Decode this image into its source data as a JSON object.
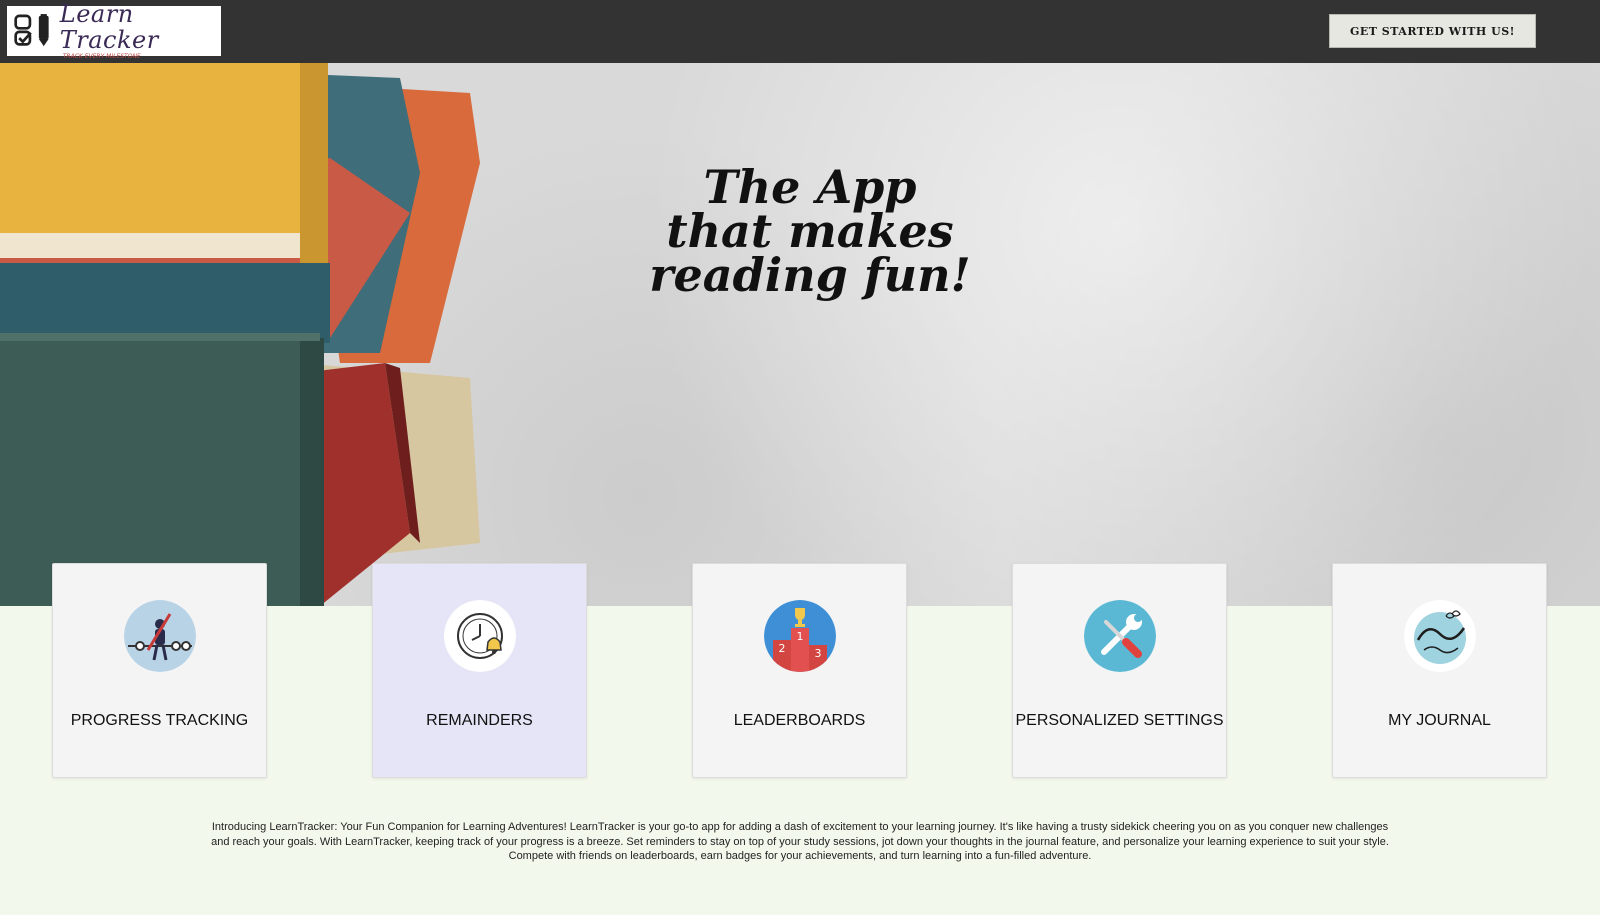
{
  "header": {
    "logo_name": "Learn Tracker",
    "logo_tagline": "TRACK EVERY MILESTONE",
    "cta_label": "GET STARTED WITH US!"
  },
  "hero": {
    "line1": "The App",
    "line2": "that makes",
    "line3": "reading fun!"
  },
  "features": [
    {
      "label": "PROGRESS TRACKING",
      "icon": "progress-tracking-icon"
    },
    {
      "label": "REMAINDERS",
      "icon": "alarm-clock-icon"
    },
    {
      "label": "LEADERBOARDS",
      "icon": "podium-trophy-icon"
    },
    {
      "label": "PERSONALIZED SETTINGS",
      "icon": "wrench-screwdriver-icon"
    },
    {
      "label": "MY JOURNAL",
      "icon": "journal-icon"
    }
  ],
  "intro_text": "Introducing LearnTracker: Your Fun Companion for Learning Adventures! LearnTracker is your go-to app for adding a dash of excitement to your learning journey. It's like having a trusty sidekick cheering you on as you conquer new challenges and reach your goals. With LearnTracker, keeping track of your progress is a breeze. Set reminders to stay on top of your study sessions, jot down your thoughts in the journal feature, and personalize your learning experience to suit your style. Compete with friends on leaderboards, earn badges for your achievements, and turn learning into a fun-filled adventure.",
  "colors": {
    "topbar": "#333333",
    "page_background": "#f3f8ec",
    "active_card": "#e6e4f7",
    "card": "#f4f4f4"
  }
}
